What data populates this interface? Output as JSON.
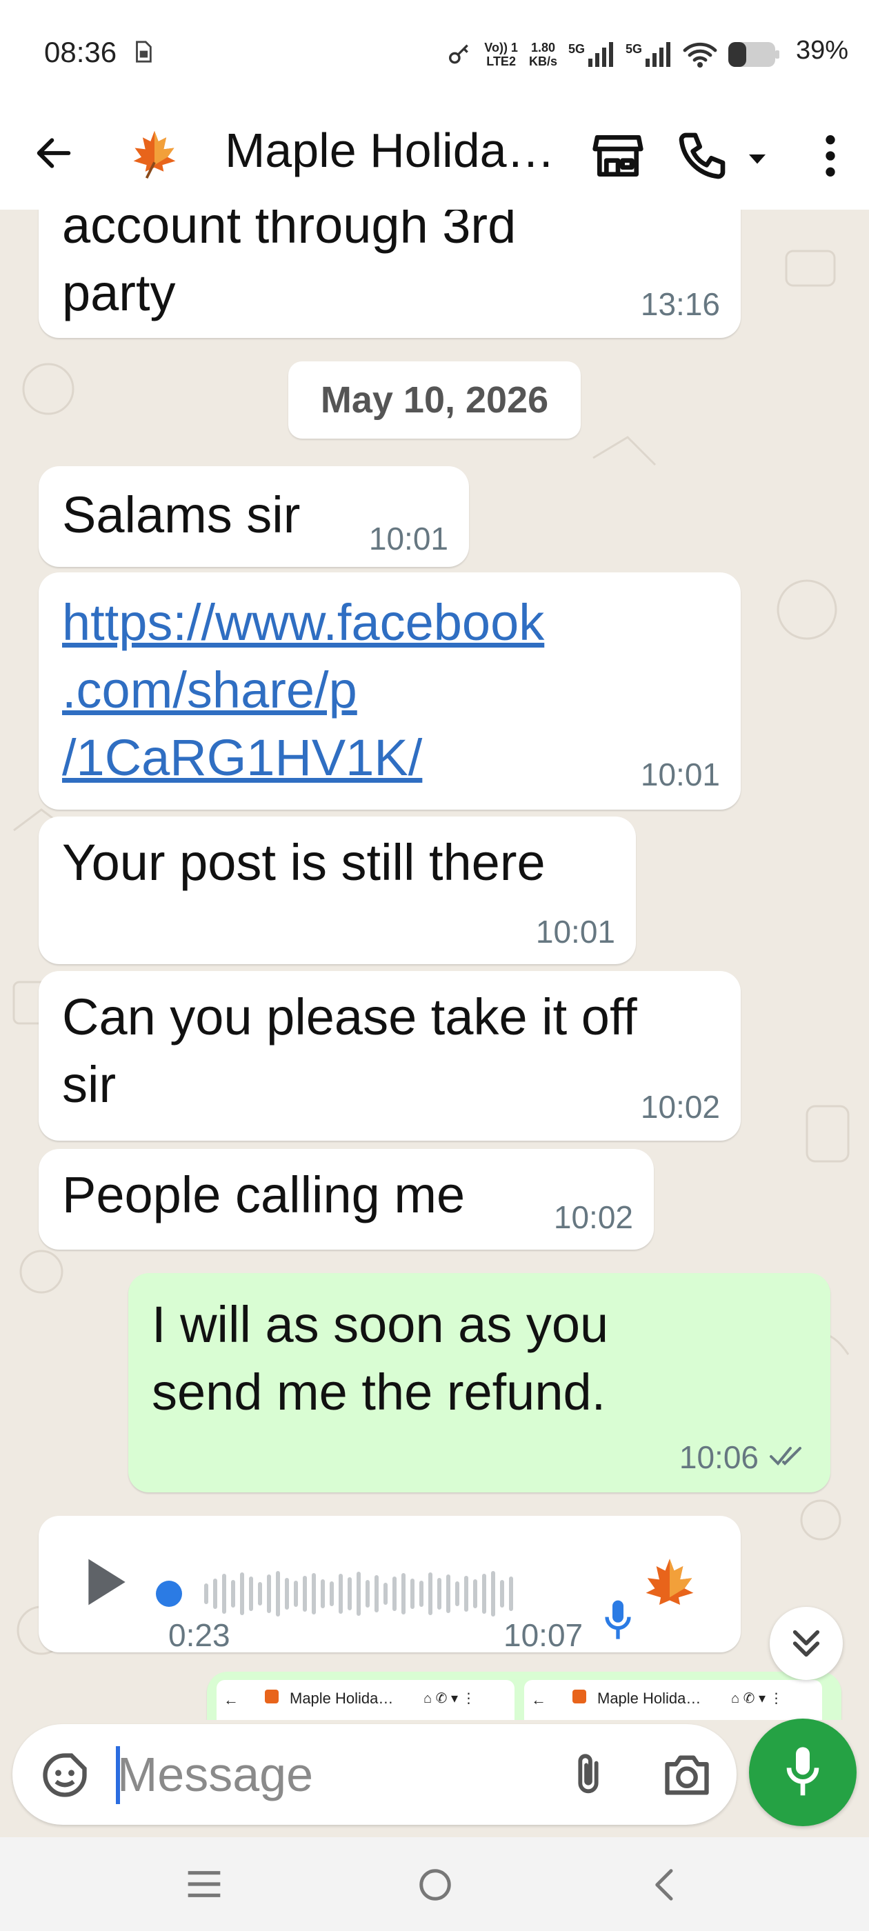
{
  "status_bar": {
    "time": "08:36",
    "volte_top": "Vo)) 1",
    "volte_bottom": "LTE2",
    "speed_value": "1.80",
    "speed_unit": "KB/s",
    "net1": "5G",
    "net2": "5G",
    "battery": "39%"
  },
  "header": {
    "title": "Maple Holida…",
    "icons": [
      "back-arrow-icon",
      "maple-leaf-icon",
      "store-icon",
      "phone-icon",
      "chevron-down-icon",
      "more-vert-icon"
    ]
  },
  "messages": [
    {
      "direction": "in",
      "text": "account through 3rd\nparty",
      "time": "13:16"
    },
    {
      "type": "date",
      "text": "May 10, 2026"
    },
    {
      "direction": "in",
      "text": "Salams sir",
      "time": "10:01"
    },
    {
      "direction": "in",
      "text": "https://www.facebook\n.com/share/p\n/1CaRG1HV1K/",
      "time": "10:01",
      "is_link": true
    },
    {
      "direction": "in",
      "text": "Your post is still there",
      "time": "10:01"
    },
    {
      "direction": "in",
      "text": "Can you please take it off\nsir",
      "time": "10:02"
    },
    {
      "direction": "in",
      "text": "People calling me",
      "time": "10:02"
    },
    {
      "direction": "out",
      "text": "I will as soon as you\nsend me the refund.",
      "time": "10:06",
      "status": "read"
    },
    {
      "direction": "in",
      "type": "voice",
      "duration": "0:23",
      "time": "10:07"
    }
  ],
  "preview_thumbs": [
    {
      "title": "Maple Holida…"
    },
    {
      "title": "Maple Holida…"
    }
  ],
  "input": {
    "placeholder": "Message"
  },
  "colors": {
    "wallpaper": "#efeae2",
    "incoming": "#ffffff",
    "outgoing": "#d9fdd3",
    "accent_green": "#25a244",
    "link": "#2f6ec2",
    "read_ticks": "#667781"
  }
}
